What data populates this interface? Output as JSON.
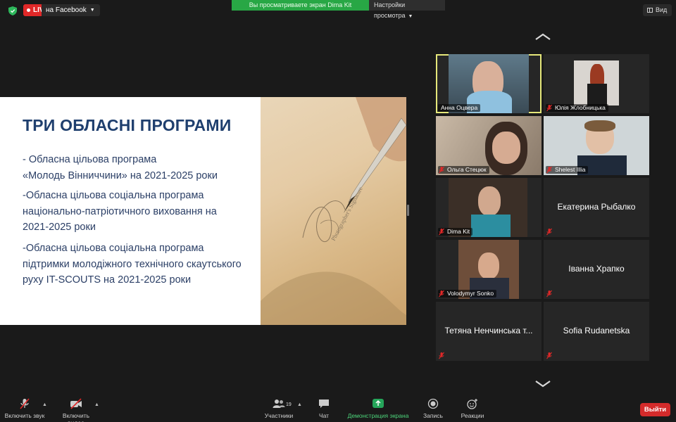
{
  "top_bar": {
    "live_label": "LIVE",
    "stream_target": "на Facebook",
    "share_banner": "Вы просматриваете экран Dima Kit",
    "view_options": "Настройки просмотра",
    "view_button": "Вид"
  },
  "slide": {
    "title": "ТРИ ОБЛАСНІ ПРОГРАМИ",
    "items": [
      "- Обласна цільова програма\n«Молодь Вінниччини» на 2021-2025 роки",
      "-Обласна цільова соціальна програма\nнаціонально-патріотичного виховання на\n2021-2025 роки",
      "-Обласна цільова соціальна програма\nпідтримки молодіжного технічного скаутського\nруху IT-SCOUTS на 2021-2025 роки"
    ],
    "photo_caption": "Photographer's Signature"
  },
  "participants": [
    {
      "name": "Анна Оцвера",
      "video": true,
      "muted": false,
      "active": true
    },
    {
      "name": "Юлія Жлобницька",
      "video": true,
      "muted": true
    },
    {
      "name": "Ольга Стецюк",
      "video": true,
      "muted": true
    },
    {
      "name": "Shelest Illia",
      "video": true,
      "muted": true
    },
    {
      "name": "Dima Kit",
      "video": true,
      "muted": true
    },
    {
      "name": "Екатерина Рыбалко",
      "video": false,
      "muted": true
    },
    {
      "name": "Volodymyr Sonko",
      "video": true,
      "muted": true
    },
    {
      "name": "Іванна Храпко",
      "video": false,
      "muted": true
    },
    {
      "name": "Тетяна Ненчинська т...",
      "video": false,
      "muted": true
    },
    {
      "name": "Sofia Rudanetska",
      "video": false,
      "muted": true
    }
  ],
  "toolbar": {
    "mute_label": "Включить звук",
    "video_label": "Включить видео",
    "participants_label": "Участники",
    "participants_count": "19",
    "chat_label": "Чат",
    "share_label": "Демонстрация экрана",
    "record_label": "Запись",
    "reactions_label": "Реакции",
    "leave_label": "Выйти"
  },
  "colors": {
    "live_red": "#e02828",
    "share_green": "#28a745",
    "active_speaker": "#e6e87a",
    "slide_title": "#1f3f6e",
    "leave_red": "#d42b2b"
  },
  "icons": [
    "shield-icon",
    "chevron-down-icon",
    "grid-view-icon",
    "chevron-up-icon",
    "muted-mic-icon",
    "video-off-icon",
    "participants-icon",
    "chat-icon",
    "share-screen-icon",
    "record-icon",
    "reactions-icon"
  ]
}
